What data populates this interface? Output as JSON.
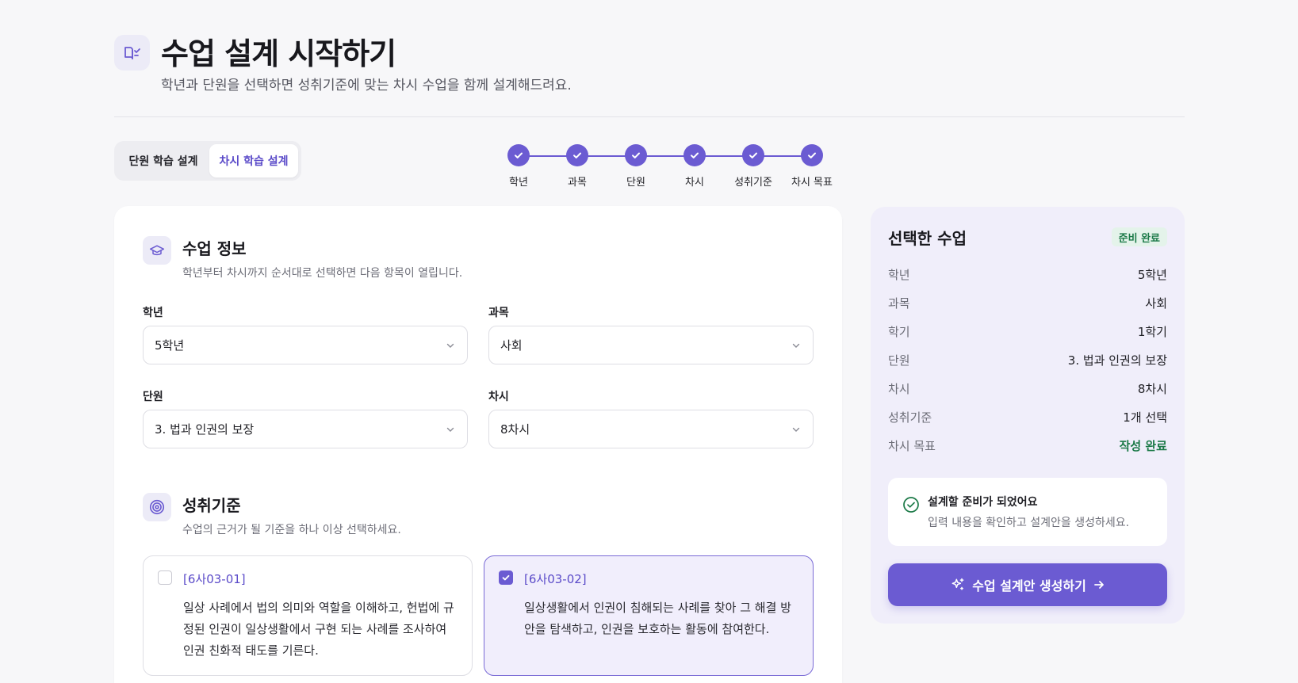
{
  "header": {
    "title": "수업 설계 시작하기",
    "subtitle": "학년과 단원을 선택하면 성취기준에 맞는 차시 수업을 함께 설계해드려요.",
    "icon": "book-check-icon"
  },
  "mode_tabs": [
    {
      "label": "단원 학습 설계",
      "active": false
    },
    {
      "label": "차시 학습 설계",
      "active": true
    }
  ],
  "stepper": {
    "steps": [
      {
        "label": "학년",
        "done": true
      },
      {
        "label": "과목",
        "done": true
      },
      {
        "label": "단원",
        "done": true
      },
      {
        "label": "차시",
        "done": true
      },
      {
        "label": "성취기준",
        "done": true
      },
      {
        "label": "차시 목표",
        "done": true
      }
    ]
  },
  "lesson_info": {
    "title": "수업 정보",
    "description": "학년부터 차시까지 순서대로 선택하면 다음 항목이 열립니다.",
    "icon": "graduation-cap-icon",
    "fields": {
      "grade": {
        "label": "학년",
        "value": "5학년"
      },
      "subject": {
        "label": "과목",
        "value": "사회"
      },
      "unit": {
        "label": "단원",
        "value": "3. 법과 인권의 보장"
      },
      "period": {
        "label": "차시",
        "value": "8차시"
      }
    }
  },
  "standards": {
    "title": "성취기준",
    "description": "수업의 근거가 될 기준을 하나 이상 선택하세요.",
    "icon": "target-icon",
    "items": [
      {
        "code": "[6사03-01]",
        "text": "일상 사례에서 법의 의미와 역할을 이해하고, 헌법에 규정된 인권이 일상생활에서 구현 되는 사례를 조사하여 인권 친화적 태도를 기른다.",
        "checked": false
      },
      {
        "code": "[6사03-02]",
        "text": "일상생활에서 인권이 침해되는 사례를 찾아 그 해결 방안을 탐색하고, 인권을 보호하는 활동에 참여한다.",
        "checked": true
      }
    ]
  },
  "summary": {
    "title": "선택한 수업",
    "badge": "준비 완료",
    "rows": [
      {
        "key": "학년",
        "value": "5학년"
      },
      {
        "key": "과목",
        "value": "사회"
      },
      {
        "key": "학기",
        "value": "1학기"
      },
      {
        "key": "단원",
        "value": "3. 법과 인권의 보장"
      },
      {
        "key": "차시",
        "value": "8차시"
      },
      {
        "key": "성취기준",
        "value": "1개 선택"
      },
      {
        "key": "차시 목표",
        "value": "작성 완료"
      }
    ],
    "notice_title": "설계할 준비가 되었어요",
    "notice_desc": "입력 내용을 확인하고 설계안을 생성하세요.",
    "generate_label": "수업 설계안 생성하기"
  },
  "colors": {
    "accent": "#6b5bd2",
    "success": "#1c7a48"
  }
}
